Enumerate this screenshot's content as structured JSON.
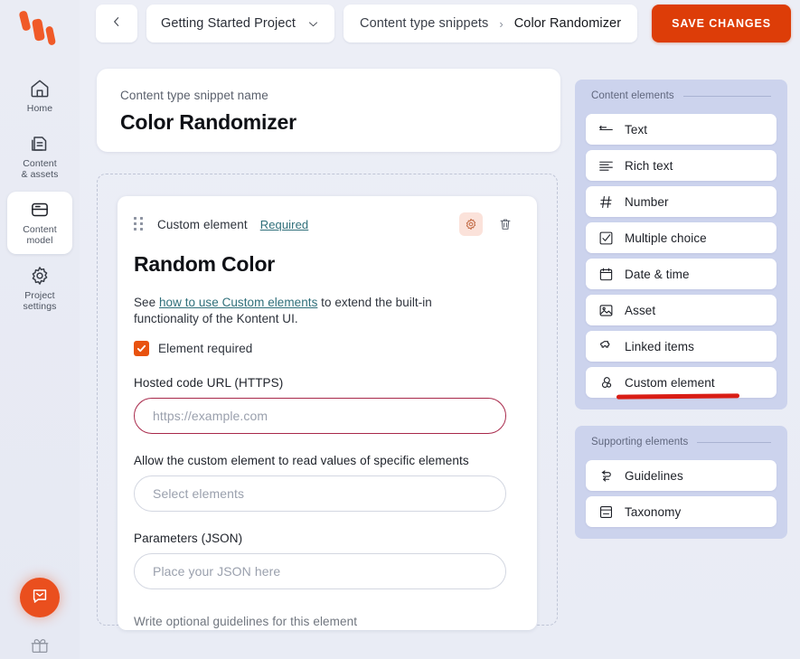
{
  "brand": {
    "logo_color": "#f05a28",
    "accent": "#dd3d08",
    "annotation_color": "#d91d15"
  },
  "sidebar": {
    "items": [
      {
        "label": "Home",
        "icon": "home-icon",
        "active": false
      },
      {
        "label": "Content\n& assets",
        "label_line1": "Content",
        "label_line2": "& assets",
        "icon": "content-assets-icon",
        "active": false
      },
      {
        "label_line1": "Content",
        "label_line2": "model",
        "icon": "content-model-icon",
        "active": true
      },
      {
        "label_line1": "Project",
        "label_line2": "settings",
        "icon": "gear-icon",
        "active": false
      }
    ],
    "chat_icon": "chat-bubble-icon",
    "gift_icon": "gift-icon"
  },
  "topbar": {
    "back_icon": "chevron-left-icon",
    "project_name": "Getting Started Project",
    "project_chevron": "chevron-down-icon",
    "breadcrumb_parent": "Content type snippets",
    "breadcrumb_separator": "›",
    "breadcrumb_current": "Color Randomizer",
    "save_label": "SAVE CHANGES"
  },
  "snippet": {
    "name_label": "Content type snippet name",
    "name_value": "Color Randomizer"
  },
  "element": {
    "type_label": "Custom element",
    "required_link": "Required",
    "gear_icon": "gear-icon",
    "delete_icon": "trash-icon",
    "drag_icon": "drag-handle-icon",
    "title": "Random Color",
    "desc_before": "See ",
    "desc_link": "how to use Custom elements",
    "desc_after": " to extend the built-in functionality of the Kontent UI.",
    "checkbox_label": "Element required",
    "checkbox_checked": true,
    "fields": [
      {
        "label": "Hosted code URL (HTTPS)",
        "placeholder": "https://example.com",
        "value": "",
        "error": true
      },
      {
        "label": "Allow the custom element to read values of specific elements",
        "placeholder": "Select elements",
        "value": "",
        "error": false
      },
      {
        "label": "Parameters (JSON)",
        "placeholder": "Place your JSON here",
        "value": "",
        "error": false
      }
    ],
    "guidelines_note": "Write optional guidelines for this element"
  },
  "right_panel": {
    "groups": [
      {
        "title": "Content elements",
        "items": [
          {
            "label": "Text",
            "icon": "text-icon"
          },
          {
            "label": "Rich text",
            "icon": "rich-text-icon"
          },
          {
            "label": "Number",
            "icon": "hash-icon"
          },
          {
            "label": "Multiple choice",
            "icon": "checkbox-icon"
          },
          {
            "label": "Date & time",
            "icon": "calendar-icon"
          },
          {
            "label": "Asset",
            "icon": "image-icon"
          },
          {
            "label": "Linked items",
            "icon": "puzzle-icon"
          },
          {
            "label": "Custom element",
            "icon": "custom-element-icon",
            "annotated": true
          }
        ]
      },
      {
        "title": "Supporting elements",
        "items": [
          {
            "label": "Guidelines",
            "icon": "guidelines-icon"
          },
          {
            "label": "Taxonomy",
            "icon": "taxonomy-icon"
          }
        ]
      }
    ]
  }
}
